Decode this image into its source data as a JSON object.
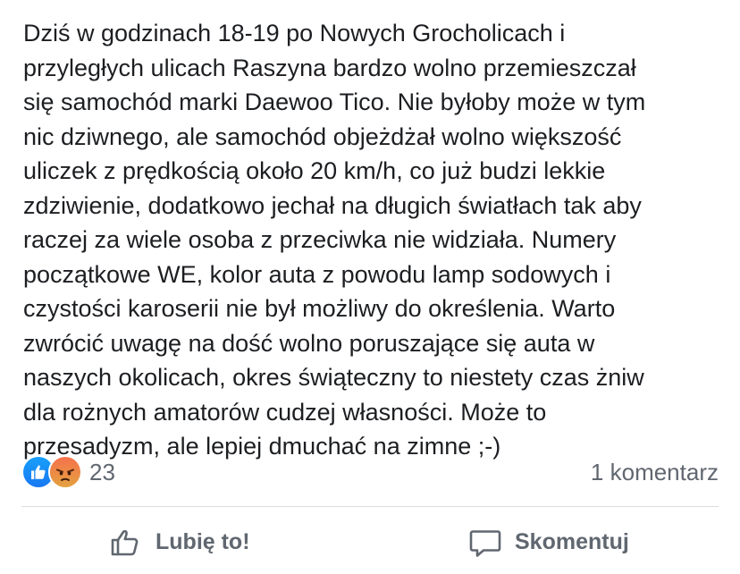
{
  "post": {
    "lines": [
      "Dziś w godzinach 18-19 po Nowych Grocholicach i",
      "przyległych ulicach Raszyna bardzo wolno przemieszczał",
      "się samochód marki Daewoo Tico. Nie byłoby może w tym",
      "nic dziwnego, ale samochód objeżdżał wolno większość",
      "uliczek z prędkością około 20 km/h, co już budzi lekkie",
      "zdziwienie, dodatkowo jechał na długich światłach tak aby",
      "raczej za wiele osoba z przeciwka nie widziała. Numery",
      "początkowe WE, kolor auta z powodu lamp sodowych i",
      "czystości karoserii nie był możliwy do określenia. Warto",
      "zwrócić uwagę na dość wolno poruszające się auta w",
      "naszych okolicach, okres świąteczny to niestety czas żniw",
      "dla rożnych amatorów cudzej własności. Może to",
      "przesadyzm, ale lepiej dmuchać na zimne ;-)"
    ]
  },
  "reactions": {
    "icons": [
      "like-reaction-icon",
      "angry-reaction-icon"
    ],
    "count": "23",
    "like_color": "#1877f2",
    "angry_color_top": "#f7714c",
    "angry_color_bottom": "#e3a23f"
  },
  "comments": {
    "count_label": "1 komentarz"
  },
  "actions": {
    "like_label": "Lubię to!",
    "like_icon": "thumbs-up-icon",
    "comment_label": "Skomentuj",
    "comment_icon": "speech-bubble-icon"
  },
  "colors": {
    "text": "#1c1e21",
    "secondary_text": "#606770",
    "divider": "#dadde1"
  }
}
